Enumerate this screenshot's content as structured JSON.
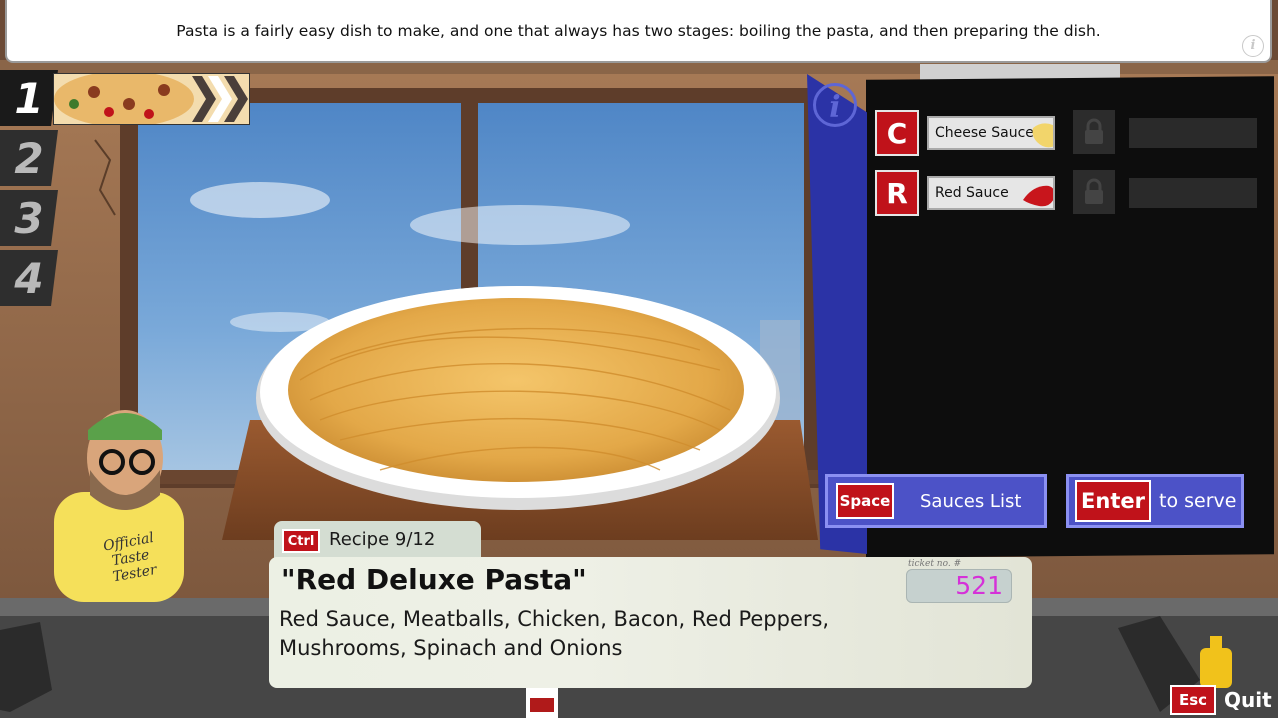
{
  "hint": {
    "text": "Pasta is a fairly easy dish to make, and one that always has two stages: boiling the pasta, and then preparing the dish."
  },
  "order_slots": [
    "1",
    "2",
    "3",
    "4"
  ],
  "active_slot": "1",
  "sauces": [
    {
      "key": "C",
      "label": "Cheese Sauce",
      "color": "#f2d56b",
      "locked_icon": "lock-icon"
    },
    {
      "key": "R",
      "label": "Red Sauce",
      "color": "#c8151c",
      "locked_icon": "lock-icon"
    }
  ],
  "actions": {
    "sauces_list": {
      "key": "Space",
      "label": "Sauces List"
    },
    "serve": {
      "key": "Enter",
      "label": "to serve"
    }
  },
  "recipe": {
    "key": "Ctrl",
    "counter": "Recipe 9/12",
    "name": "\"Red Deluxe Pasta\"",
    "ingredients": "Red Sauce, Meatballs, Chicken, Bacon, Red Peppers, Mushrooms, Spinach and Onions",
    "ticket_label": "ticket no. #",
    "ticket_number": "521"
  },
  "character": {
    "shirt_text": "Official Taste Tester"
  },
  "quit": {
    "key": "Esc",
    "label": "Quit"
  },
  "colors": {
    "key_red": "#c0121a",
    "action_blue": "#4c52c7",
    "ticket_pink": "#d531d8",
    "panel_black": "#0d0d0d"
  }
}
